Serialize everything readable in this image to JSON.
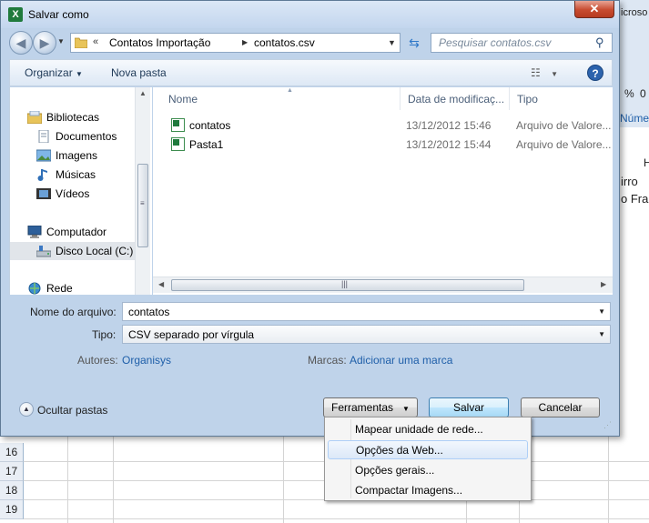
{
  "window": {
    "title": "Salvar como",
    "close_label": "✕"
  },
  "background_app": {
    "right_snippets": [
      "icroso",
      "%",
      "0",
      "Número",
      "H",
      "irro",
      "o Fra"
    ],
    "row_numbers": [
      "16",
      "17",
      "18",
      "19"
    ]
  },
  "address_bar": {
    "overflow": "«",
    "crumbs": [
      "Contatos Importação",
      "contatos.csv"
    ],
    "search_placeholder": "Pesquisar contatos.csv"
  },
  "toolbar": {
    "organize": "Organizar",
    "new_folder": "Nova pasta"
  },
  "nav_pane": {
    "items": [
      {
        "label": "Bibliotecas",
        "icon": "library-icon"
      },
      {
        "label": "Documentos",
        "icon": "documents-icon"
      },
      {
        "label": "Imagens",
        "icon": "pictures-icon"
      },
      {
        "label": "Músicas",
        "icon": "music-icon"
      },
      {
        "label": "Vídeos",
        "icon": "videos-icon"
      },
      {
        "label": "Computador",
        "icon": "computer-icon"
      },
      {
        "label": "Disco Local (C:)",
        "icon": "drive-icon",
        "selected": true
      },
      {
        "label": "Rede",
        "icon": "network-icon"
      }
    ]
  },
  "file_list": {
    "columns": [
      "Nome",
      "Data de modificaç...",
      "Tipo"
    ],
    "rows": [
      {
        "name": "contatos",
        "date": "13/12/2012 15:46",
        "type": "Arquivo de Valore..."
      },
      {
        "name": "Pasta1",
        "date": "13/12/2012 15:44",
        "type": "Arquivo de Valore..."
      }
    ]
  },
  "form": {
    "filename_label": "Nome do arquivo:",
    "filename_value": "contatos",
    "type_label": "Tipo:",
    "type_value": "CSV separado por vírgula",
    "authors_label": "Autores:",
    "authors_value": "Organisys",
    "tags_label": "Marcas:",
    "tags_value": "Adicionar uma marca"
  },
  "footer": {
    "hide_folders": "Ocultar pastas",
    "tools": "Ferramentas",
    "save": "Salvar",
    "cancel": "Cancelar"
  },
  "tools_menu": {
    "items": [
      "Mapear unidade de rede...",
      "Opções da Web...",
      "Opções gerais...",
      "Compactar Imagens..."
    ],
    "highlighted_index": 1
  }
}
